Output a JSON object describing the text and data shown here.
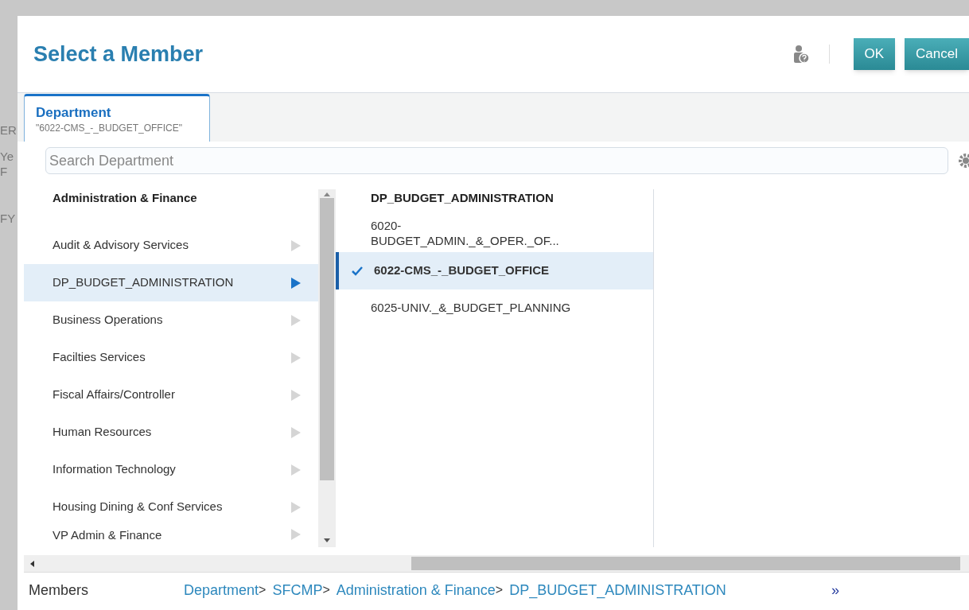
{
  "background_fragments": [
    "ER",
    "Ye",
    "F",
    "FY"
  ],
  "dialog": {
    "title": "Select a Member",
    "buttons": [
      {
        "label": "OK",
        "kind": "primary"
      },
      {
        "label": "Cancel",
        "kind": "primary"
      }
    ]
  },
  "tabs": [
    {
      "label": "Department",
      "value": "\"6022-CMS_-_BUDGET_OFFICE\"",
      "selected": true
    }
  ],
  "search": {
    "placeholder": "Search Department"
  },
  "left_column": {
    "header": "Administration & Finance",
    "items": [
      {
        "label": "Audit & Advisory Services",
        "selected": false
      },
      {
        "label": "DP_BUDGET_ADMINISTRATION",
        "selected": true
      },
      {
        "label": "Business Operations",
        "selected": false
      },
      {
        "label": "Facilties Services",
        "selected": false
      },
      {
        "label": "Fiscal Affairs/Controller",
        "selected": false
      },
      {
        "label": "Human Resources",
        "selected": false
      },
      {
        "label": "Information Technology",
        "selected": false
      },
      {
        "label": "Housing Dining & Conf Services",
        "selected": false
      },
      {
        "label": "VP Admin & Finance",
        "selected": false
      }
    ]
  },
  "middle_column": {
    "header": "DP_BUDGET_ADMINISTRATION",
    "items": [
      {
        "label": "6020-\nBUDGET_ADMIN._&_OPER._OF...",
        "selected": false
      },
      {
        "label": "6022-CMS_-_BUDGET_OFFICE",
        "selected": true
      },
      {
        "label": "6025-UNIV._&_BUDGET_PLANNING",
        "selected": false
      }
    ]
  },
  "footer": {
    "label": "Members",
    "separator": ">",
    "breadcrumb": [
      "Department",
      "SFCMP",
      "Administration & Finance",
      "DP_BUDGET_ADMINISTRATION"
    ],
    "more": "»"
  }
}
